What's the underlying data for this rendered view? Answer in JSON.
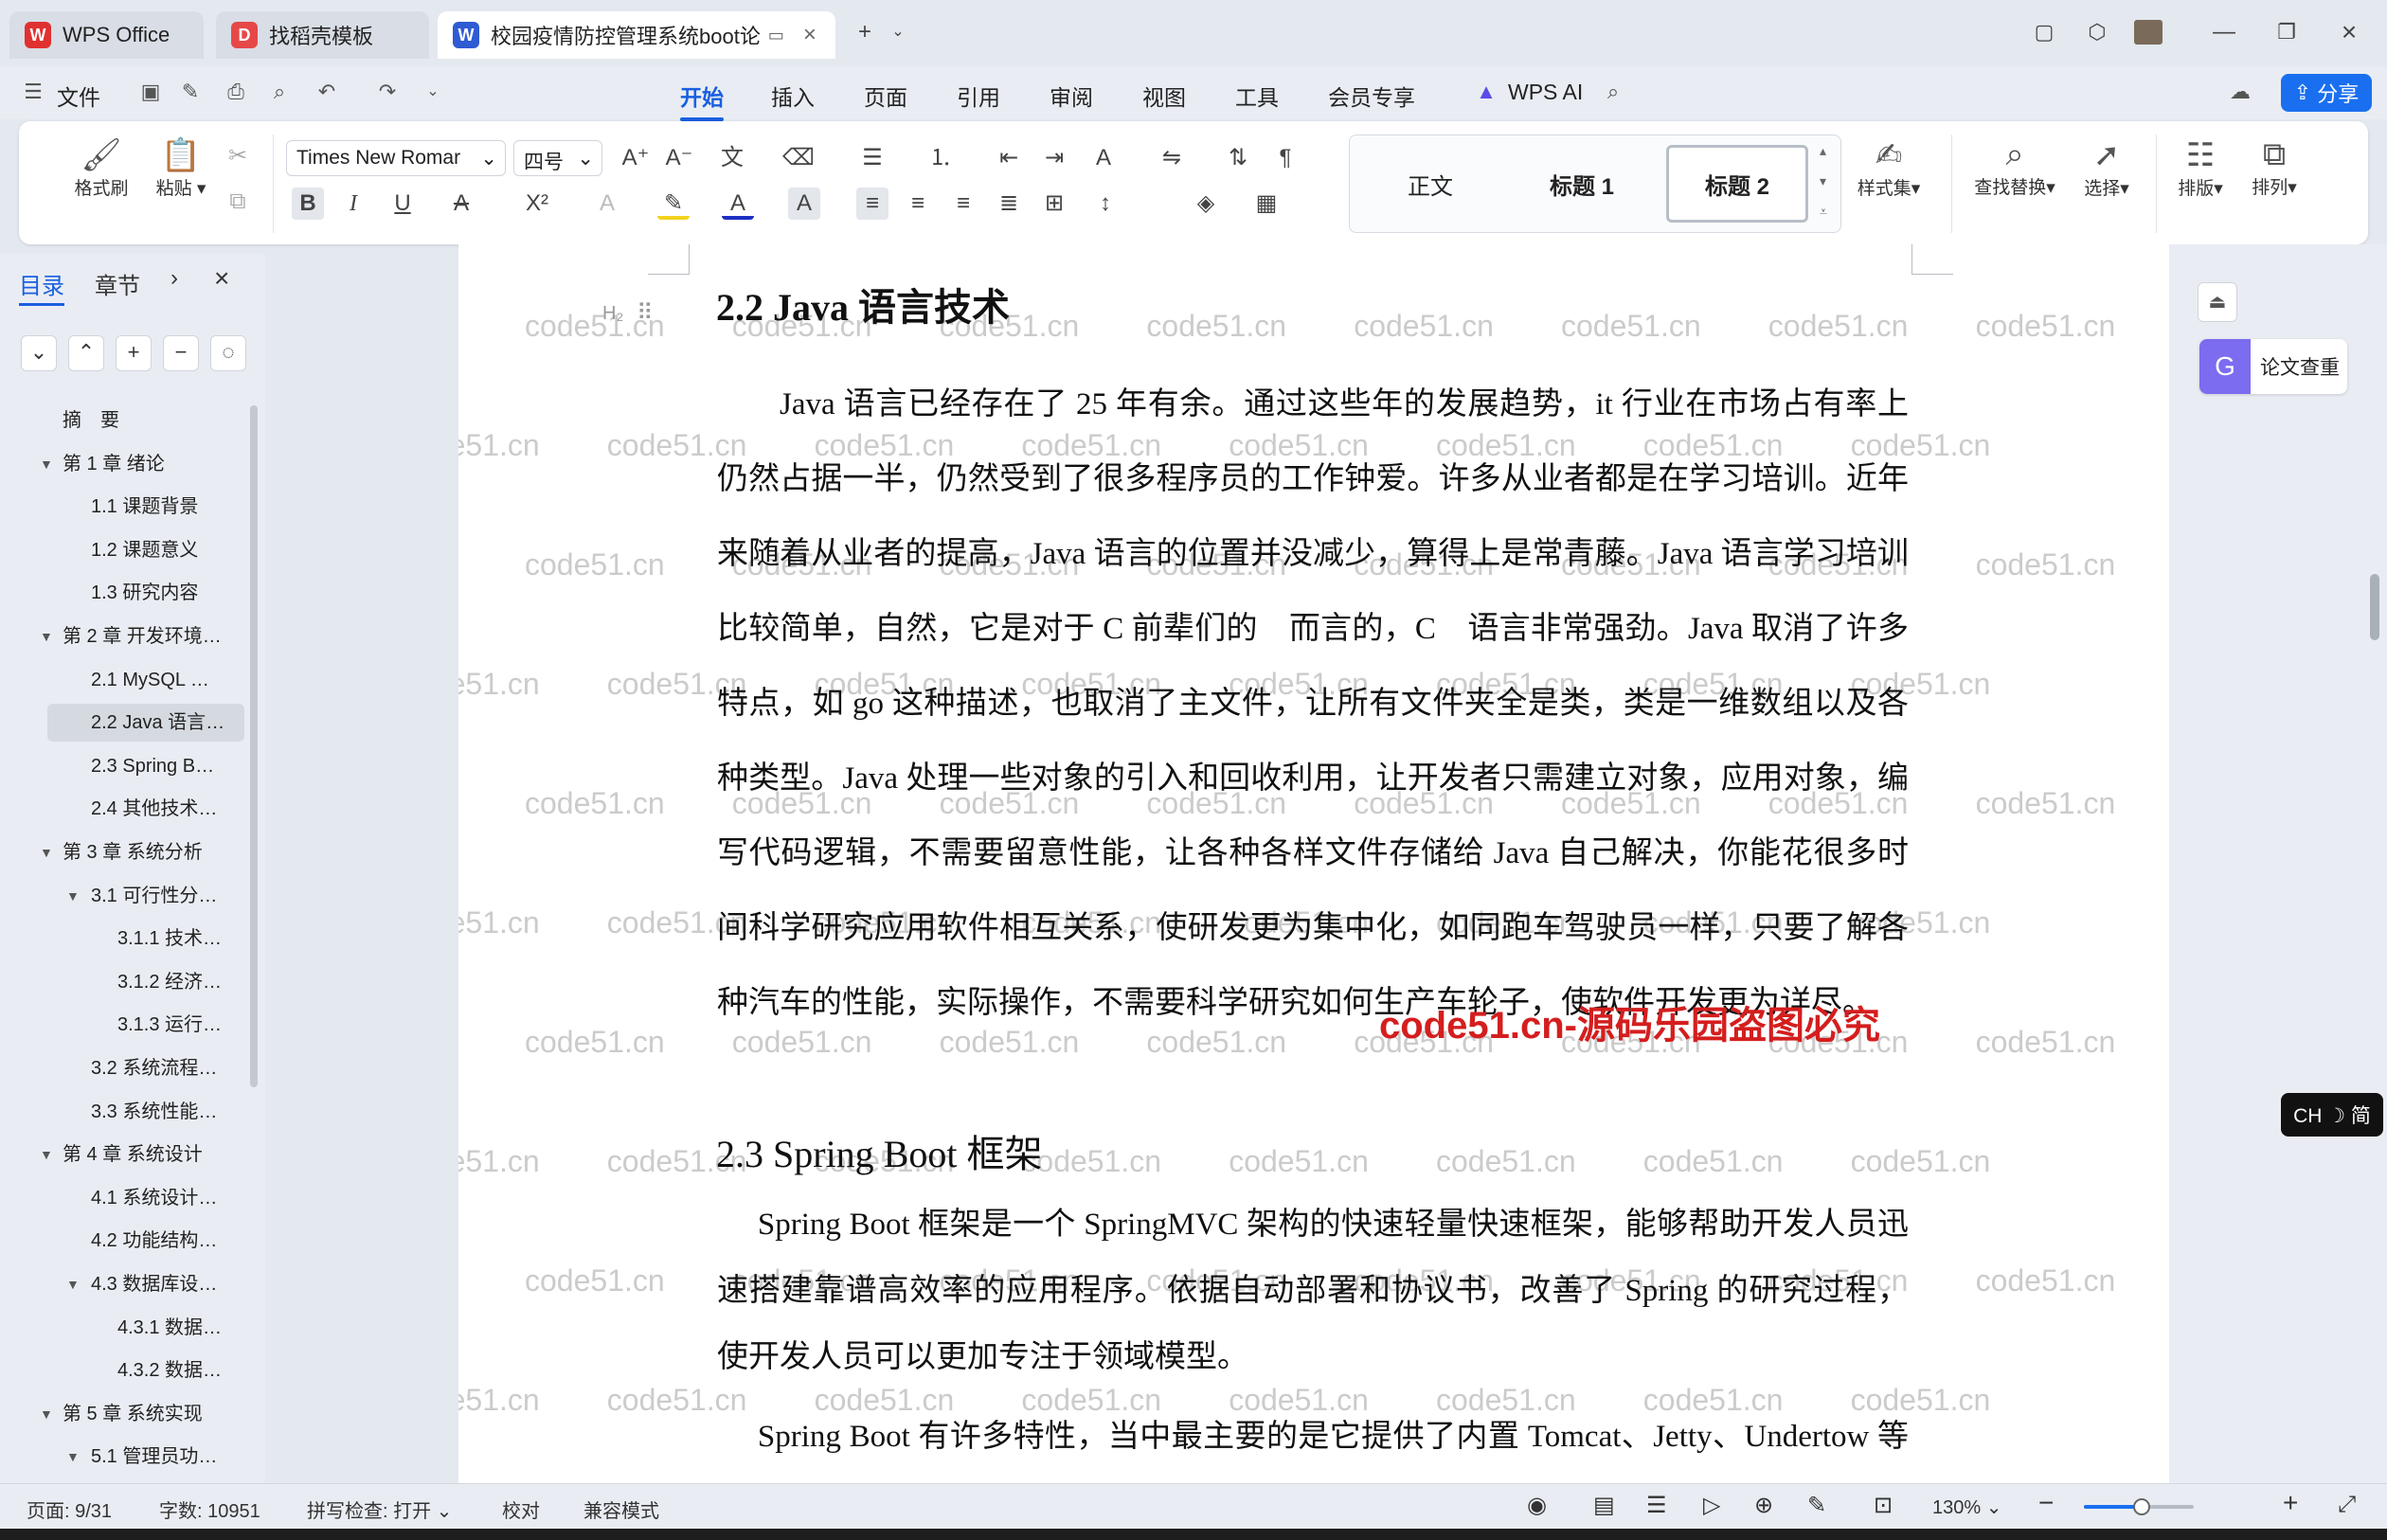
{
  "tabs": [
    {
      "label": "WPS Office",
      "icon": "wps-logo-icon",
      "color": "#e03131"
    },
    {
      "label": "找稻壳模板",
      "icon": "docer-logo-icon",
      "color": "#e64848"
    },
    {
      "label": "校园疫情防控管理系统boot论",
      "icon": "word-doc-icon",
      "color": "#2f5bd3"
    }
  ],
  "menu": {
    "file": "文件",
    "items": [
      "开始",
      "插入",
      "页面",
      "引用",
      "审阅",
      "视图",
      "工具",
      "会员专享"
    ],
    "active": "开始",
    "ai": "WPS AI",
    "share": "分享"
  },
  "ribbon": {
    "format_painter": "格式刷",
    "paste": "粘贴",
    "font_name": "Times New Romar",
    "font_size": "四号",
    "styles": [
      "正文",
      "标题 1",
      "标题 2"
    ],
    "selected_style": "标题 2",
    "style_set": "样式集",
    "find_replace": "查找替换",
    "select": "选择",
    "layout": "排版",
    "arrange": "排列"
  },
  "nav": {
    "tabs": [
      "目录",
      "章节"
    ],
    "active_tab": "目录",
    "toc": [
      {
        "label": "摘　要",
        "level": 1,
        "arrow": ""
      },
      {
        "label": "第 1 章 绪论",
        "level": 1,
        "arrow": "▼"
      },
      {
        "label": "1.1 课题背景",
        "level": 2,
        "arrow": ""
      },
      {
        "label": "1.2 课题意义",
        "level": 2,
        "arrow": ""
      },
      {
        "label": "1.3 研究内容",
        "level": 2,
        "arrow": ""
      },
      {
        "label": "第 2 章 开发环境…",
        "level": 1,
        "arrow": "▼"
      },
      {
        "label": "2.1 MySQL …",
        "level": 2,
        "arrow": ""
      },
      {
        "label": "2.2 Java 语言…",
        "level": 2,
        "arrow": "",
        "selected": true
      },
      {
        "label": "2.3 Spring B…",
        "level": 2,
        "arrow": ""
      },
      {
        "label": "2.4 其他技术…",
        "level": 2,
        "arrow": ""
      },
      {
        "label": "第 3 章 系统分析",
        "level": 1,
        "arrow": "▼"
      },
      {
        "label": "3.1 可行性分…",
        "level": 2,
        "arrow": "▼"
      },
      {
        "label": "3.1.1 技术…",
        "level": 3,
        "arrow": ""
      },
      {
        "label": "3.1.2 经济…",
        "level": 3,
        "arrow": ""
      },
      {
        "label": "3.1.3 运行…",
        "level": 3,
        "arrow": ""
      },
      {
        "label": "3.2 系统流程…",
        "level": 2,
        "arrow": ""
      },
      {
        "label": "3.3 系统性能…",
        "level": 2,
        "arrow": ""
      },
      {
        "label": "第 4 章 系统设计",
        "level": 1,
        "arrow": "▼"
      },
      {
        "label": "4.1 系统设计…",
        "level": 2,
        "arrow": ""
      },
      {
        "label": "4.2 功能结构…",
        "level": 2,
        "arrow": ""
      },
      {
        "label": "4.3 数据库设…",
        "level": 2,
        "arrow": "▼"
      },
      {
        "label": "4.3.1 数据…",
        "level": 3,
        "arrow": ""
      },
      {
        "label": "4.3.2 数据…",
        "level": 3,
        "arrow": ""
      },
      {
        "label": "第 5 章 系统实现",
        "level": 1,
        "arrow": "▼"
      },
      {
        "label": "5.1 管理员功…",
        "level": 2,
        "arrow": "▼"
      }
    ]
  },
  "doc": {
    "heading1": "2.2 Java 语言技术",
    "para1": "Java 语言已经存在了 25 年有余。通过这些年的发展趋势，it 行业在市场占有率上仍然占据一半，仍然受到了很多程序员的工作钟爱。许多从业者都是在学习培训。近年来随着从业者的提高，Java 语言的位置并没减少，算得上是常青藤。Java 语言学习培训比较简单，自然，它是对于 C 前辈们的　而言的，C　语言非常强劲。Java 取消了许多特点，如 go 这种描述，也取消了主文件，让所有文件夹全是类，类是一维数组以及各种类型。Java 处理一些对象的引入和回收利用，让开发者只需建立对象，应用对象，编写代码逻辑，不需要留意性能，让各种各样文件存储给 Java 自己解决，你能花很多时间科学研究应用软件相互关系，使研发更为集中化，如同跑车驾驶员一样，只要了解各种汽车的性能，实际操作，不需要科学研究如何生产车轮子，使软件开发更为详尽。",
    "heading2": "2.3 Spring Boot 框架",
    "para2": "Spring Boot 框架是一个 SpringMVC 架构的快速轻量快速框架，能够帮助开发人员迅速搭建靠谱高效率的应用程序。依据自动部署和协议书，改善了 Spring 的研究过程，使开发人员可以更加专注于领域模型。",
    "para3": "Spring Boot 有许多特性，当中最主要的是它提供了内置 Tomcat、Jetty、Undertow 等 Web 网络服务器能够轻松搭建 Web 应用程序，除此之外，它也提供",
    "watermark": "code51.cn",
    "red_watermark": "code51.cn-源码乐园盗图必究",
    "heading_marker": "H₂"
  },
  "right": {
    "essay_check": "论文查重",
    "ime": "CH ☽ 简"
  },
  "status": {
    "page": "页面: 9/31",
    "words": "字数: 10951",
    "spell": "拼写检查: 打开",
    "proof": "校对",
    "compat": "兼容模式",
    "zoom": "130%",
    "zoom_level": 0.53
  },
  "colors": {
    "accent": "#1a5fe0",
    "share": "#1a6ff0",
    "watermark_red": "#d41e1e"
  }
}
